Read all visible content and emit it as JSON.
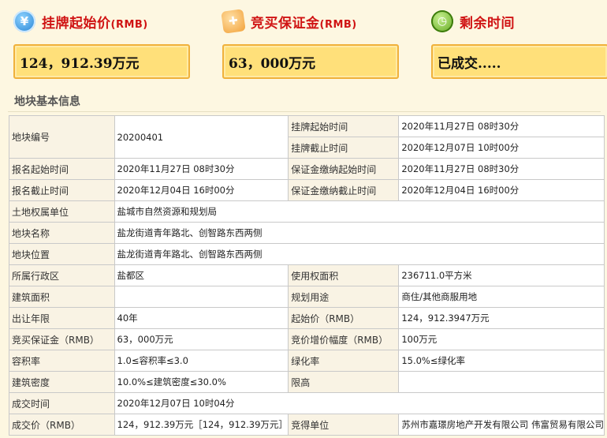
{
  "header": {
    "price": {
      "icon": "coin-icon",
      "label": "挂牌起始价",
      "unit": "(RMB)",
      "value": "124，912.39万元"
    },
    "deposit": {
      "icon": "gift-icon",
      "label": "竞买保证金",
      "unit": "(RMB)",
      "value": "63，000万元"
    },
    "time": {
      "icon": "clock-icon",
      "label": "剩余时间",
      "value": "已成交....."
    }
  },
  "section_title": "地块基本信息",
  "table": {
    "r1": {
      "l1": "地块编号",
      "v1": "20200401",
      "l2": "挂牌起始时间",
      "v2": "2020年11月27日 08时30分"
    },
    "r2": {
      "l2": "挂牌截止时间",
      "v2": "2020年12月07日 10时00分"
    },
    "r3": {
      "l1": "报名起始时间",
      "v1": "2020年11月27日 08时30分",
      "l2": "保证金缴纳起始时间",
      "v2": "2020年11月27日 08时30分"
    },
    "r4": {
      "l1": "报名截止时间",
      "v1": "2020年12月04日 16时00分",
      "l2": "保证金缴纳截止时间",
      "v2": "2020年12月04日 16时00分"
    },
    "r5": {
      "l1": "土地权属单位",
      "v1": "盐城市自然资源和规划局"
    },
    "r6": {
      "l1": "地块名称",
      "v1": "盐龙街道青年路北、创智路东西两侧"
    },
    "r7": {
      "l1": "地块位置",
      "v1": "盐龙街道青年路北、创智路东西两侧"
    },
    "r8": {
      "l1": "所属行政区",
      "v1": "盐都区",
      "l2": "使用权面积",
      "v2": "236711.0平方米"
    },
    "r9": {
      "l1": "建筑面积",
      "v1": "",
      "l2": "规划用途",
      "v2": "商住/其他商服用地"
    },
    "r10": {
      "l1": "出让年限",
      "v1": "40年",
      "l2": "起始价（RMB）",
      "v2": "124，912.3947万元"
    },
    "r11": {
      "l1": "竞买保证金（RMB）",
      "v1": "63，000万元",
      "l2": "竞价增价幅度（RMB）",
      "v2": "100万元"
    },
    "r12": {
      "l1": "容积率",
      "v1": "1.0≤容积率≤3.0",
      "l2": "绿化率",
      "v2": "15.0%≤绿化率"
    },
    "r13": {
      "l1": "建筑密度",
      "v1": "10.0%≤建筑密度≤30.0%",
      "l2": "限高",
      "v2": ""
    },
    "r14": {
      "l1": "成交时间",
      "v1": "2020年12月07日 10时04分"
    },
    "r15": {
      "l1": "成交价（RMB）",
      "v1": "124，912.39万元［124，912.39万元］",
      "l2": "竞得单位",
      "v2": "苏州市嘉璟房地产开发有限公司 伟富贸易有限公司"
    }
  }
}
